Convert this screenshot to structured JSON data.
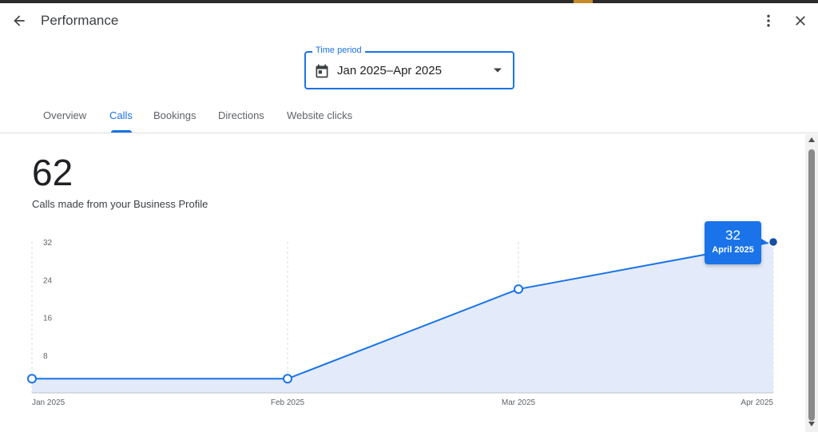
{
  "header": {
    "title": "Performance",
    "back_icon": "arrow-back-icon",
    "more_icon": "more-vert-icon",
    "close_icon": "close-icon"
  },
  "time_period": {
    "label": "Time period",
    "value": "Jan 2025–Apr 2025",
    "icon": "calendar-icon"
  },
  "tabs": [
    {
      "label": "Overview",
      "active": false
    },
    {
      "label": "Calls",
      "active": true
    },
    {
      "label": "Bookings",
      "active": false
    },
    {
      "label": "Directions",
      "active": false
    },
    {
      "label": "Website clicks",
      "active": false
    }
  ],
  "summary": {
    "total": "62",
    "description": "Calls made from your Business Profile"
  },
  "tooltip": {
    "value": "32",
    "label": "April 2025"
  },
  "colors": {
    "accent": "#1a73e8",
    "area_fill": "#e3ebfb",
    "selected_point": "#174ea6"
  },
  "chart_data": {
    "type": "area",
    "categories": [
      "Jan 2025",
      "Feb 2025",
      "Mar 2025",
      "Apr 2025"
    ],
    "values": [
      3,
      3,
      22,
      32
    ],
    "y_ticks": [
      "8",
      "16",
      "24",
      "32"
    ],
    "ylim": [
      0,
      32
    ],
    "selected_index": 3,
    "grid": "vertical dashed"
  }
}
